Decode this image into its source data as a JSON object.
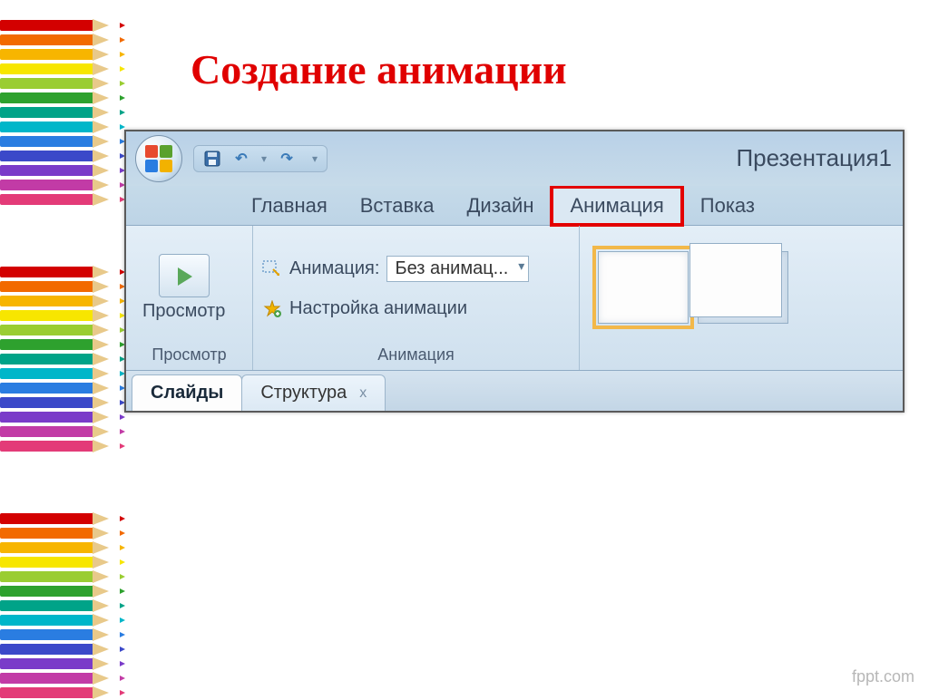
{
  "slide": {
    "title": "Создание анимации"
  },
  "app": {
    "doc_title": "Презентация1"
  },
  "tabs": {
    "home": "Главная",
    "insert": "Вставка",
    "design": "Дизайн",
    "animation": "Анимация",
    "slideshow": "Показ"
  },
  "ribbon": {
    "preview_btn": "Просмотр",
    "preview_group": "Просмотр",
    "anim_label": "Анимация:",
    "anim_value": "Без анимац...",
    "anim_settings": "Настройка анимации",
    "anim_group": "Анимация"
  },
  "bottom_tabs": {
    "slides": "Слайды",
    "outline": "Структура",
    "close": "x"
  },
  "watermark": "fppt.com",
  "pencil_colors": [
    "#d30000",
    "#f26a00",
    "#f7b500",
    "#f7e600",
    "#9acd32",
    "#2ea12e",
    "#00a388",
    "#00b6c9",
    "#2a7de1",
    "#3b49c9",
    "#7a3bc9",
    "#c23ba6",
    "#e33b78"
  ]
}
